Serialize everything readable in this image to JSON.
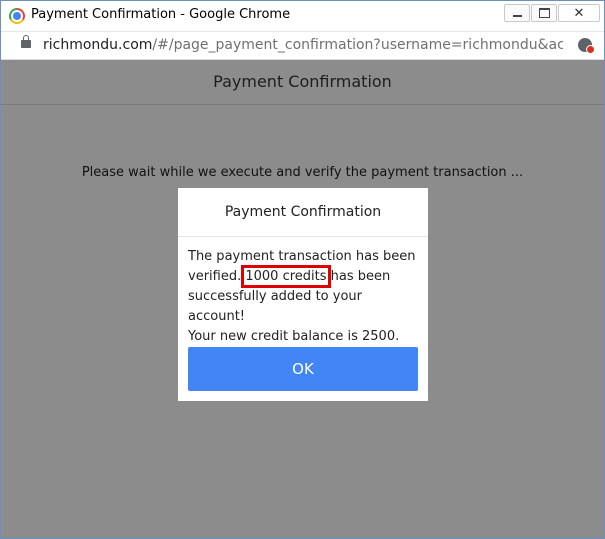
{
  "window": {
    "title": "Payment Confirmation - Google Chrome"
  },
  "addressbar": {
    "url_host": "richmondu.com",
    "url_path": "/#/page_payment_confirmation?username=richmondu&access=e..."
  },
  "page": {
    "title": "Payment Confirmation",
    "wait_message": "Please wait while we execute and verify the payment transaction ..."
  },
  "modal": {
    "title": "Payment Confirmation",
    "line1_prefix": "The payment transaction has been verified. ",
    "credits_highlight": "1000 credits",
    "line1_suffix": " has been successfully added to your account!",
    "line2": "Your new credit balance is 2500.",
    "ok_label": "OK"
  },
  "colors": {
    "accent": "#4285f4",
    "highlight_border": "#e00000",
    "overlay": "#8c8c8c"
  }
}
